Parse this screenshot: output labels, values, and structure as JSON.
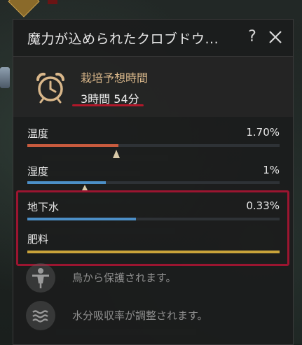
{
  "window": {
    "title": "魔力が込められたクロブドウ...",
    "help_label": "?",
    "close_icon": "close-icon",
    "help_icon": "question-icon"
  },
  "growth": {
    "icon": "alarm-clock-icon",
    "label": "栽培予想時間",
    "value": "3時間 54分"
  },
  "stats": [
    {
      "label": "温度",
      "value": "1.70%",
      "fill": 0.36,
      "color": "#c85b3e"
    },
    {
      "label": "湿度",
      "value": "1%",
      "fill": 0.31,
      "color": "#4c8fc7"
    },
    {
      "label": "地下水",
      "value": "0.33%",
      "fill": 0.43,
      "color": "#4c8fc7"
    },
    {
      "label": "肥料",
      "value": "",
      "fill": 1.0,
      "color": "#c9a33a"
    }
  ],
  "effects": [
    {
      "icon": "scarecrow-icon",
      "text": "鳥から保護されます。"
    },
    {
      "icon": "water-absorption-icon",
      "text": "水分吸収率が調整されます。"
    }
  ],
  "colors": {
    "panel_bg": "#1b1c1c",
    "accent_gold": "#d9b78a",
    "highlight_red": "#9b1530"
  }
}
